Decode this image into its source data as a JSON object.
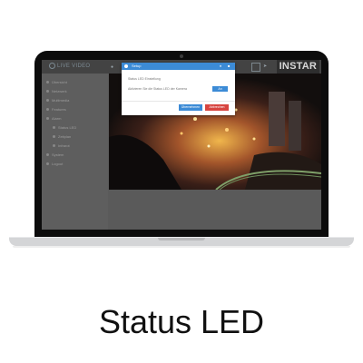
{
  "app": {
    "brand": "LIVE VIDEO",
    "logo": "INSTAR"
  },
  "sidebar": {
    "items": [
      {
        "label": "Übersicht",
        "indent": false
      },
      {
        "label": "Netzwerk",
        "indent": false
      },
      {
        "label": "Multimedia",
        "indent": false
      },
      {
        "label": "Features",
        "indent": false
      },
      {
        "label": "Alarm",
        "indent": false
      },
      {
        "label": "Status LED",
        "indent": true
      },
      {
        "label": "Zeitplan",
        "indent": true
      },
      {
        "label": "Infrarot",
        "indent": true
      },
      {
        "label": "System",
        "indent": false
      },
      {
        "label": "Logout",
        "indent": false
      }
    ]
  },
  "modal": {
    "title": "Setup",
    "line1": "Status LED Einstellung",
    "line2": "Aktivieren Sie die Status LED der Kamera",
    "select_value": "An",
    "save_label": "Übernehmen",
    "cancel_label": "Abbrechen"
  },
  "caption": "Status LED",
  "colors": {
    "accent": "#3c8bd6",
    "danger": "#d7443f"
  }
}
